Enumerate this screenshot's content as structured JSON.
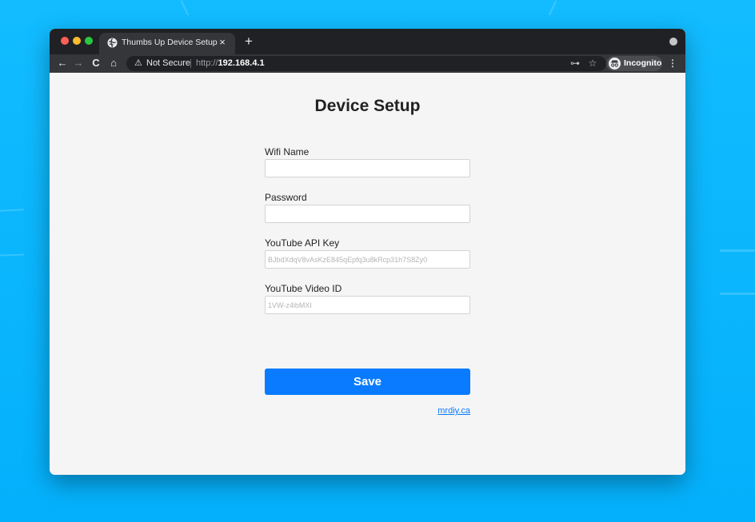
{
  "browser": {
    "tab": {
      "title": "Thumbs Up Device Setup",
      "close": "×"
    },
    "new_tab": "+",
    "toolbar": {
      "back": "←",
      "forward": "→",
      "reload": "C",
      "home": "⌂",
      "security_warning": "⚠",
      "security_label": "Not Secure",
      "url_scheme": "http://",
      "url_host": "192.168.4.1",
      "key": "⊶",
      "star": "☆",
      "profile_label": "Incognito",
      "menu": "⋮"
    }
  },
  "page": {
    "title": "Device Setup",
    "fields": [
      {
        "label": "Wifi Name",
        "value": "",
        "placeholder": ""
      },
      {
        "label": "Password",
        "value": "",
        "placeholder": ""
      },
      {
        "label": "YouTube API Key",
        "value": "",
        "placeholder": "BJbdXdqV8vAsKzE845qEpfq3u8kRcp31h7S8Zy0"
      },
      {
        "label": "YouTube Video ID",
        "value": "",
        "placeholder": "1VW-z4ibMXI"
      }
    ],
    "save_label": "Save",
    "credit_link": "mrdiy.ca"
  },
  "colors": {
    "desktop": "#0ab7ff",
    "accent": "#0a7bff",
    "chrome_dark": "#202124",
    "chrome_toolbar": "#35363a"
  },
  "icons": {
    "tab_favicon": "globe-icon",
    "back": "arrow-left-icon",
    "forward": "arrow-right-icon",
    "reload": "reload-icon",
    "home": "home-icon",
    "security": "warning-triangle-icon",
    "key": "key-icon",
    "star": "star-icon",
    "profile": "incognito-icon",
    "menu": "kebab-menu-icon"
  }
}
